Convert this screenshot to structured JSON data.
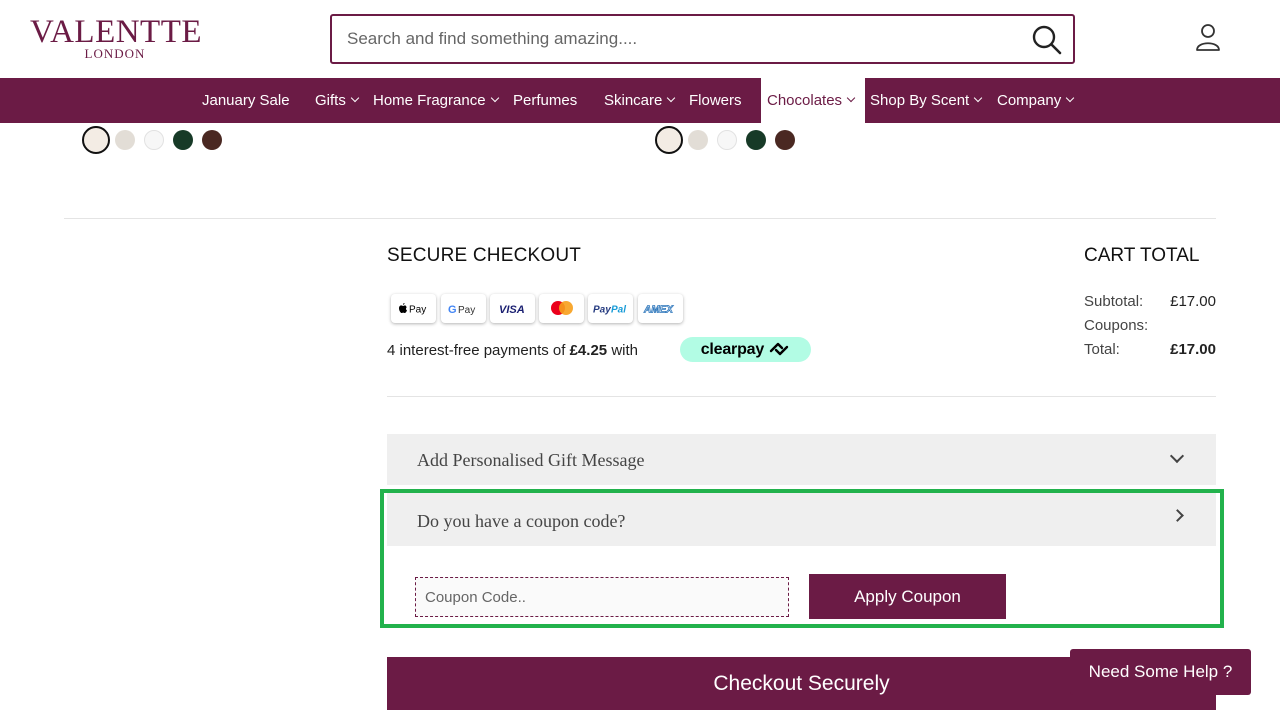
{
  "brand": {
    "name": "VALENTTE",
    "location": "LONDON",
    "color": "#6b1b45"
  },
  "search": {
    "placeholder": "Search and find something amazing....",
    "icon": "search-icon"
  },
  "header": {
    "account_icon": "user-icon"
  },
  "nav": {
    "items": [
      {
        "label": "January Sale",
        "dropdown": false
      },
      {
        "label": "Gifts",
        "dropdown": true
      },
      {
        "label": "Home Fragrance",
        "dropdown": true
      },
      {
        "label": "Perfumes",
        "dropdown": false
      },
      {
        "label": "Skincare",
        "dropdown": true
      },
      {
        "label": "Flowers",
        "dropdown": false
      },
      {
        "label": "Chocolates",
        "dropdown": true,
        "active": true
      },
      {
        "label": "Shop By Scent",
        "dropdown": true
      },
      {
        "label": "Company",
        "dropdown": true
      }
    ]
  },
  "swatches": {
    "colors": [
      "#f3ece4",
      "#e2ddd6",
      "#f7f7f7",
      "#173a27",
      "#4a2822"
    ],
    "selected_index": 0
  },
  "checkout": {
    "title": "SECURE CHECKOUT",
    "payment_methods": [
      "Apple Pay",
      "Google Pay",
      "Visa",
      "Mastercard",
      "PayPal",
      "Amex"
    ],
    "installments_prefix": "4 interest-free payments of",
    "installments_amount": "£4.25",
    "installments_suffix": "with",
    "clearpay_label": "clearpay"
  },
  "cart": {
    "title": "CART TOTAL",
    "subtotal_label": "Subtotal:",
    "subtotal_value": "£17.00",
    "coupons_label": "Coupons:",
    "total_label": "Total:",
    "total_value": "£17.00"
  },
  "gift_message": {
    "title": "Add Personalised Gift Message"
  },
  "coupon": {
    "title": "Do you have a coupon code?",
    "input_placeholder": "Coupon Code..",
    "apply_label": "Apply Coupon"
  },
  "actions": {
    "checkout_label": "Checkout Securely",
    "help_label": "Need Some Help ?"
  },
  "colors": {
    "highlight": "#22b24c",
    "clearpay_bg": "#b2fce4"
  }
}
